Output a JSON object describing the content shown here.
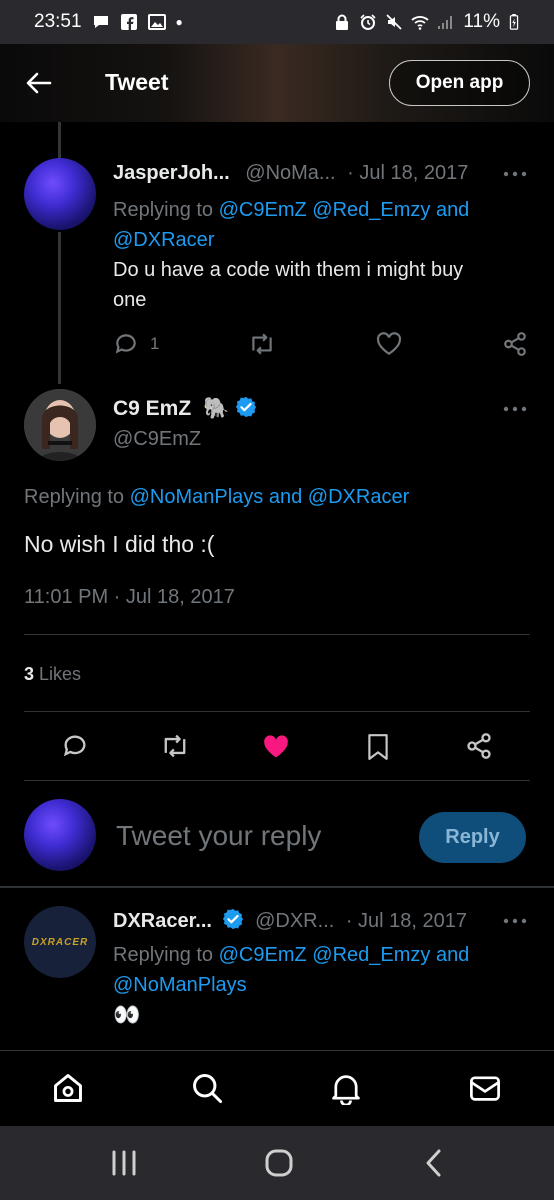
{
  "status_bar": {
    "time": "23:51",
    "battery": "11%"
  },
  "header": {
    "title": "Tweet",
    "open_app_label": "Open app"
  },
  "reply_tweet": {
    "display_name": "JasperJoh...",
    "handle": "@NoMa...",
    "date": "· Jul 18, 2017",
    "replying_prefix": "Replying to",
    "replying_line1": "@C9EmZ @Red_Emzy and",
    "replying_line2": "@DXRacer",
    "text_line1": "Do u have a code with them i might buy",
    "text_line2": "one",
    "reply_count": "1"
  },
  "main_tweet": {
    "display_name": "C9 EmZ",
    "handle": "@C9EmZ",
    "replying_prefix": "Replying to",
    "replying_to": "@NoManPlays and @DXRacer",
    "text": "No wish I did tho :(",
    "timestamp": "11:01 PM · Jul 18, 2017",
    "likes_count": "3",
    "likes_label": "Likes",
    "liked": true
  },
  "compose": {
    "placeholder": "Tweet your reply",
    "reply_label": "Reply"
  },
  "next_tweet": {
    "display_name": "DXRacer...",
    "handle": "@DXR...",
    "date": "· Jul 18, 2017",
    "replying_prefix": "Replying to",
    "replying_line1": "@C9EmZ @Red_Emzy and",
    "replying_line2": "@NoManPlays",
    "text": "👀",
    "avatar_logo_text": "DXRACER"
  },
  "colors": {
    "accent": "#1d9bf0",
    "like": "#f91880",
    "muted": "#71767b"
  }
}
